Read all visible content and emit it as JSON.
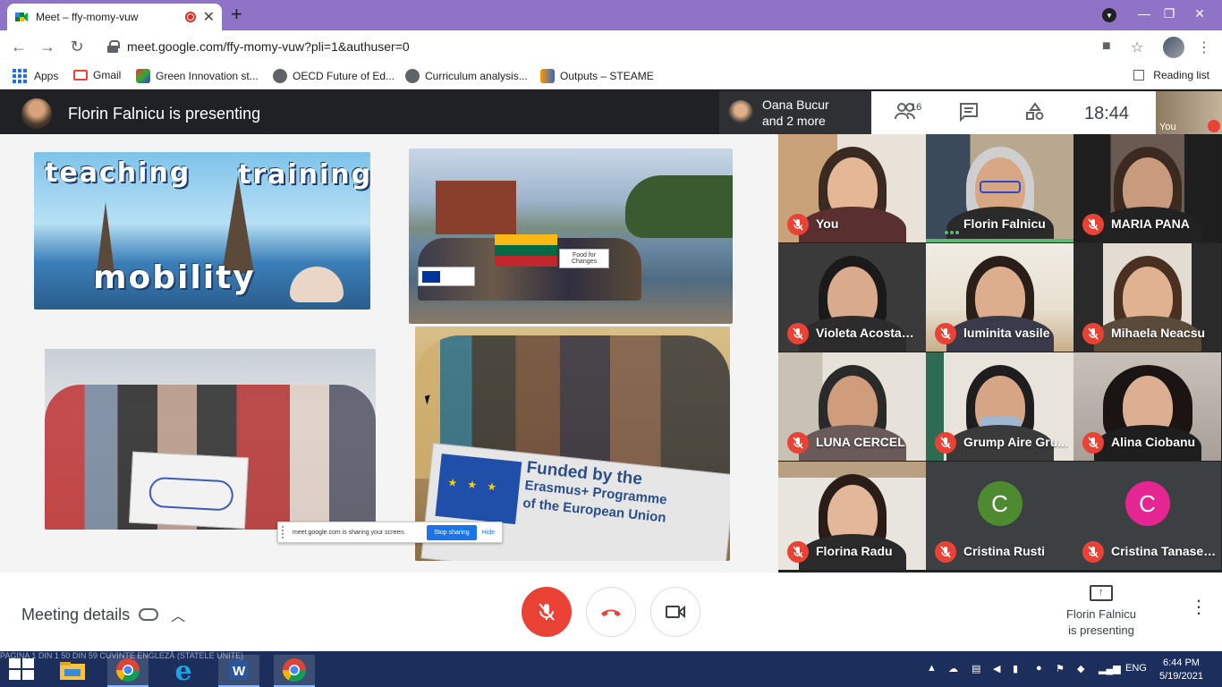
{
  "browser": {
    "tab_title": "Meet – ffy-momy-vuw",
    "url": "meet.google.com/ffy-momy-vuw?pli=1&authuser=0",
    "bookmarks": [
      {
        "label": "Apps"
      },
      {
        "label": "Gmail"
      },
      {
        "label": "Green Innovation st..."
      },
      {
        "label": "OECD Future of Ed..."
      },
      {
        "label": "Curriculum analysis..."
      },
      {
        "label": "Outputs – STEAME"
      }
    ],
    "reading_list": "Reading list"
  },
  "meet": {
    "presenting_title": "Florin Falnicu is presenting",
    "speaker_chip": {
      "line1": "Oana Bucur",
      "line2": "and 2 more"
    },
    "participants_count": "16",
    "time": "18:44",
    "self_label": "You",
    "share_bar": {
      "text": "meet.google.com is sharing your screen.",
      "stop": "Stop sharing",
      "hide": "Hide"
    },
    "slide_words": {
      "teaching": "teaching",
      "training": "training",
      "mobility": "mobility"
    },
    "banner_text": {
      "line1": "Funded by the",
      "line2": "Erasmus+ Programme",
      "line3": "of the European Union"
    },
    "small_banner": "Food for Changes",
    "tiles": [
      {
        "name": "You",
        "muted": true
      },
      {
        "name": "Florin Falnicu",
        "muted": false
      },
      {
        "name": "MARIA PANA",
        "muted": true
      },
      {
        "name": "Violeta Acostant...",
        "muted": true
      },
      {
        "name": "luminita vasile",
        "muted": true
      },
      {
        "name": "Mihaela Neacsu",
        "muted": true
      },
      {
        "name": "LUNA CERCEL",
        "muted": true
      },
      {
        "name": "Grump Aire Gru...",
        "muted": true
      },
      {
        "name": "Alina Ciobanu",
        "muted": true
      },
      {
        "name": "Florina Radu",
        "muted": true
      },
      {
        "name": "Cristina Rusti",
        "muted": true,
        "letter": "C"
      },
      {
        "name": "Cristina Tanases...",
        "muted": true,
        "letter": "C"
      }
    ],
    "controls": {
      "meeting_details": "Meeting details",
      "presenting_line1": "Florin Falnicu",
      "presenting_line2": "is presenting"
    }
  },
  "taskbar": {
    "word_status": "PAGINA 1 DIN 1     50 DIN 59 CUVINTE     ENGLEZĂ (STATELE UNITE)",
    "lang": "ENG",
    "time": "6:44 PM",
    "date": "5/19/2021"
  },
  "colors": {
    "accent_red": "#ea4335",
    "meet_dark": "#202124",
    "tab_strip": "#8e73c7",
    "taskbar": "#1c2f5c"
  }
}
